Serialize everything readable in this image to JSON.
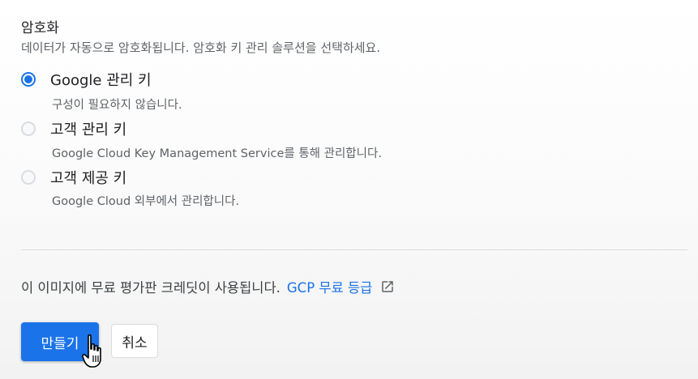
{
  "encryption": {
    "title": "암호화",
    "description": "데이터가 자동으로 암호화됩니다. 암호화 키 관리 솔루션을 선택하세요.",
    "options": [
      {
        "label": "Google 관리 키",
        "sublabel": "구성이 필요하지 않습니다.",
        "selected": true
      },
      {
        "label": "고객 관리 키",
        "sublabel": "Google Cloud Key Management Service를 통해 관리합니다.",
        "selected": false
      },
      {
        "label": "고객 제공 키",
        "sublabel": "Google Cloud 외부에서 관리합니다.",
        "selected": false
      }
    ]
  },
  "credit": {
    "text": "이 이미지에 무료 평가판 크레딧이 사용됩니다.",
    "link_label": "GCP 무료 등급",
    "link_icon": "external-link-icon"
  },
  "actions": {
    "create_label": "만들기",
    "cancel_label": "취소"
  },
  "colors": {
    "accent": "#1a73e8",
    "text_primary": "#202124",
    "text_secondary": "#5f6368"
  }
}
